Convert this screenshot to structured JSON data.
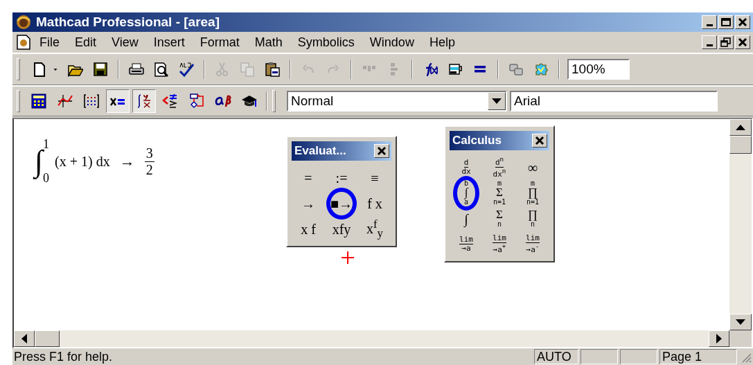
{
  "window": {
    "title": "Mathcad Professional - [area]"
  },
  "menu": [
    "File",
    "Edit",
    "View",
    "Insert",
    "Format",
    "Math",
    "Symbolics",
    "Window",
    "Help"
  ],
  "standard_toolbar": [
    {
      "kind": "new",
      "disabled": false
    },
    {
      "kind": "caret",
      "disabled": false
    },
    {
      "kind": "open",
      "disabled": false
    },
    {
      "kind": "save",
      "disabled": false
    },
    {
      "kind": "separator"
    },
    {
      "kind": "print",
      "disabled": false
    },
    {
      "kind": "preview",
      "disabled": false
    },
    {
      "kind": "spell",
      "disabled": false
    },
    {
      "kind": "separator"
    },
    {
      "kind": "cut",
      "disabled": true
    },
    {
      "kind": "copy",
      "disabled": true
    },
    {
      "kind": "paste",
      "disabled": false
    },
    {
      "kind": "separator"
    },
    {
      "kind": "undo",
      "disabled": true
    },
    {
      "kind": "redo",
      "disabled": true
    },
    {
      "kind": "separator"
    },
    {
      "kind": "align-across",
      "disabled": true
    },
    {
      "kind": "align-down",
      "disabled": true
    },
    {
      "kind": "separator"
    },
    {
      "kind": "function",
      "disabled": false
    },
    {
      "kind": "unit",
      "disabled": false
    },
    {
      "kind": "calculate",
      "disabled": false
    },
    {
      "kind": "separator"
    },
    {
      "kind": "resource",
      "disabled": false
    },
    {
      "kind": "component",
      "disabled": false
    },
    {
      "kind": "separator"
    }
  ],
  "zoom": {
    "value": "100%"
  },
  "math_toolbar": [
    {
      "kind": "calculator",
      "selected": false
    },
    {
      "kind": "graph",
      "selected": false
    },
    {
      "kind": "matrix",
      "selected": false
    },
    {
      "kind": "evaluation",
      "selected": true
    },
    {
      "kind": "calculus",
      "selected": true
    },
    {
      "kind": "boolean",
      "selected": false
    },
    {
      "kind": "programming",
      "selected": false
    },
    {
      "kind": "greek",
      "selected": false
    },
    {
      "kind": "symbolic",
      "selected": false
    }
  ],
  "style_field": {
    "value": "Normal"
  },
  "font_field": {
    "value": "Arial"
  },
  "expression": {
    "symbol": "∫",
    "upper": "1",
    "lower": "0",
    "integrand": "(x + 1) dx",
    "arrow": "→",
    "numerator": "3",
    "denominator": "2"
  },
  "palettes": [
    {
      "title": "Evaluat...",
      "items": [
        {
          "kind": "glyph",
          "text": "=",
          "highlighted": false
        },
        {
          "kind": "glyph",
          "text": ":=",
          "highlighted": false
        },
        {
          "kind": "glyph",
          "text": "≡",
          "highlighted": false
        },
        {
          "kind": "glyph",
          "text": "→",
          "highlighted": false
        },
        {
          "kind": "glyph",
          "text": "■→",
          "highlighted": true
        },
        {
          "kind": "glyph",
          "text": "f x",
          "highlighted": false
        },
        {
          "kind": "glyph",
          "text": "x f",
          "highlighted": false
        },
        {
          "kind": "glyph",
          "text": "xfy",
          "highlighted": false
        },
        {
          "kind": "glyph",
          "text": "x$^{f}$$_{y}$",
          "highlighted": false
        }
      ]
    },
    {
      "title": "Calculus",
      "items": [
        {
          "kind": "frac",
          "top": "d",
          "bottom": "dx",
          "highlighted": false
        },
        {
          "kind": "frac",
          "top": "d$^{n}$",
          "bottom": "dx$^{n}$",
          "highlighted": false
        },
        {
          "kind": "glyph",
          "text": "∞",
          "highlighted": false
        },
        {
          "kind": "op",
          "symbol": "∫",
          "top": "b",
          "bottom": "a",
          "highlighted": true
        },
        {
          "kind": "op",
          "symbol": "Σ",
          "top": "m",
          "bottom": "n=1",
          "highlighted": false
        },
        {
          "kind": "op",
          "symbol": "∏",
          "top": "m",
          "bottom": "n=1",
          "highlighted": false
        },
        {
          "kind": "glyph",
          "text": "∫",
          "highlighted": false
        },
        {
          "kind": "op",
          "symbol": "Σ",
          "bottom": "n",
          "highlighted": false
        },
        {
          "kind": "op",
          "symbol": "∏",
          "bottom": "n",
          "highlighted": false
        },
        {
          "kind": "frac",
          "top": "lim",
          "bottom": "→a",
          "highlighted": false
        },
        {
          "kind": "frac",
          "top": "lim",
          "bottom": "→a$^{+}$",
          "highlighted": false
        },
        {
          "kind": "frac",
          "top": "lim",
          "bottom": "→a$^{-}$",
          "highlighted": false
        }
      ]
    }
  ],
  "status_bar": {
    "message": "Press F1 for help.",
    "mode": "AUTO",
    "page": "Page 1"
  }
}
